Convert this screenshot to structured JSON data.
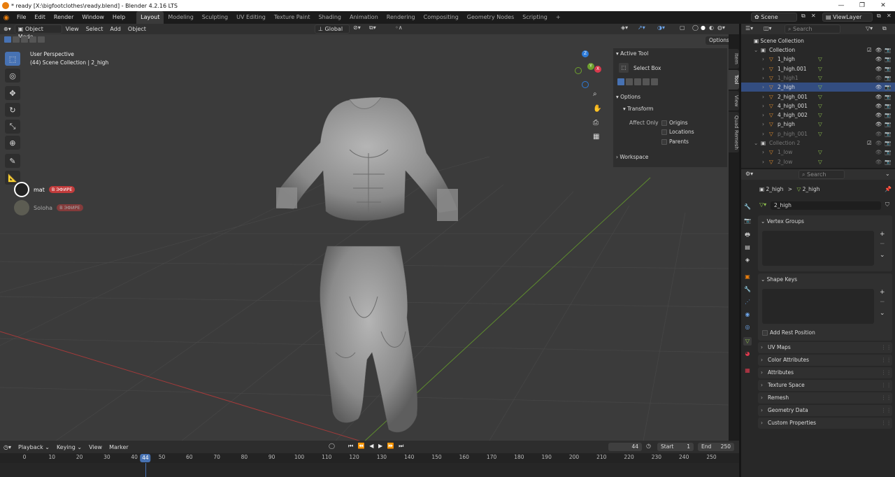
{
  "window": {
    "title": "* ready [X:\\bigfootclothes\\ready.blend] - Blender 4.2.16 LTS",
    "min": "—",
    "max": "❐",
    "close": "✕"
  },
  "menu": [
    "File",
    "Edit",
    "Render",
    "Window",
    "Help"
  ],
  "workspaces": [
    "Layout",
    "Modeling",
    "Sculpting",
    "UV Editing",
    "Texture Paint",
    "Shading",
    "Animation",
    "Rendering",
    "Compositing",
    "Geometry Nodes",
    "Scripting"
  ],
  "add_workspace": "+",
  "scene": {
    "label": "Scene",
    "viewlayer": "ViewLayer"
  },
  "viewport": {
    "mode": "Object Mode",
    "menus": [
      "View",
      "Select",
      "Add",
      "Object"
    ],
    "orientation": "Global",
    "options_label": "Options",
    "info_line1": "User Perspective",
    "info_line2": "(44) Scene Collection | 2_high",
    "gizmo": {
      "z": "Z",
      "y": "Y",
      "x": "X"
    },
    "side_tabs": [
      "Item",
      "Tool",
      "View",
      "Quad Remesh"
    ]
  },
  "overlay_users": [
    {
      "name": "mat",
      "badge": "В ЭФИРЕ"
    },
    {
      "name": "Soloha",
      "badge": "В ЭФИРЕ"
    }
  ],
  "npanel": {
    "active_tool": "Active Tool",
    "select_box": "Select Box",
    "options": "Options",
    "transform": "Transform",
    "affect_only": "Affect Only",
    "origins": "Origins",
    "locations": "Locations",
    "parents": "Parents",
    "workspace": "Workspace"
  },
  "outliner": {
    "search_placeholder": "Search",
    "root": "Scene Collection",
    "items": [
      {
        "name": "Collection",
        "dim": false,
        "sel": false,
        "indent": 1
      },
      {
        "name": "1_high",
        "dim": false,
        "sel": false,
        "indent": 2
      },
      {
        "name": "1_high.001",
        "dim": false,
        "sel": false,
        "indent": 2
      },
      {
        "name": "1_high1",
        "dim": true,
        "sel": false,
        "indent": 2
      },
      {
        "name": "2_high",
        "dim": false,
        "sel": true,
        "indent": 2
      },
      {
        "name": "2_high_001",
        "dim": false,
        "sel": false,
        "indent": 2
      },
      {
        "name": "4_high_001",
        "dim": false,
        "sel": false,
        "indent": 2
      },
      {
        "name": "4_high_002",
        "dim": false,
        "sel": false,
        "indent": 2
      },
      {
        "name": "p_high",
        "dim": false,
        "sel": false,
        "indent": 2
      },
      {
        "name": "p_high_001",
        "dim": true,
        "sel": false,
        "indent": 2
      },
      {
        "name": "Collection 2",
        "dim": true,
        "sel": false,
        "indent": 1
      },
      {
        "name": "1_low",
        "dim": true,
        "sel": false,
        "indent": 2
      },
      {
        "name": "2_low",
        "dim": true,
        "sel": false,
        "indent": 2
      }
    ]
  },
  "properties": {
    "search_placeholder": "Search",
    "breadcrumb_obj": "2_high",
    "breadcrumb_sep": ">",
    "breadcrumb_data": "2_high",
    "mesh_name": "2_high",
    "vertex_groups": "Vertex Groups",
    "shape_keys": "Shape Keys",
    "add_rest_position": "Add Rest Position",
    "sections": [
      "UV Maps",
      "Color Attributes",
      "Attributes",
      "Texture Space",
      "Remesh",
      "Geometry Data",
      "Custom Properties"
    ]
  },
  "timeline": {
    "menus": [
      "Playback",
      "Keying",
      "View",
      "Marker"
    ],
    "current_frame": "44",
    "start_label": "Start",
    "start": "1",
    "end_label": "End",
    "end": "250",
    "ticks": [
      "0",
      "10",
      "20",
      "30",
      "40",
      "50",
      "60",
      "70",
      "80",
      "90",
      "100",
      "110",
      "120",
      "130",
      "140",
      "150",
      "160",
      "170",
      "180",
      "190",
      "200",
      "210",
      "220",
      "230",
      "240",
      "250"
    ]
  }
}
